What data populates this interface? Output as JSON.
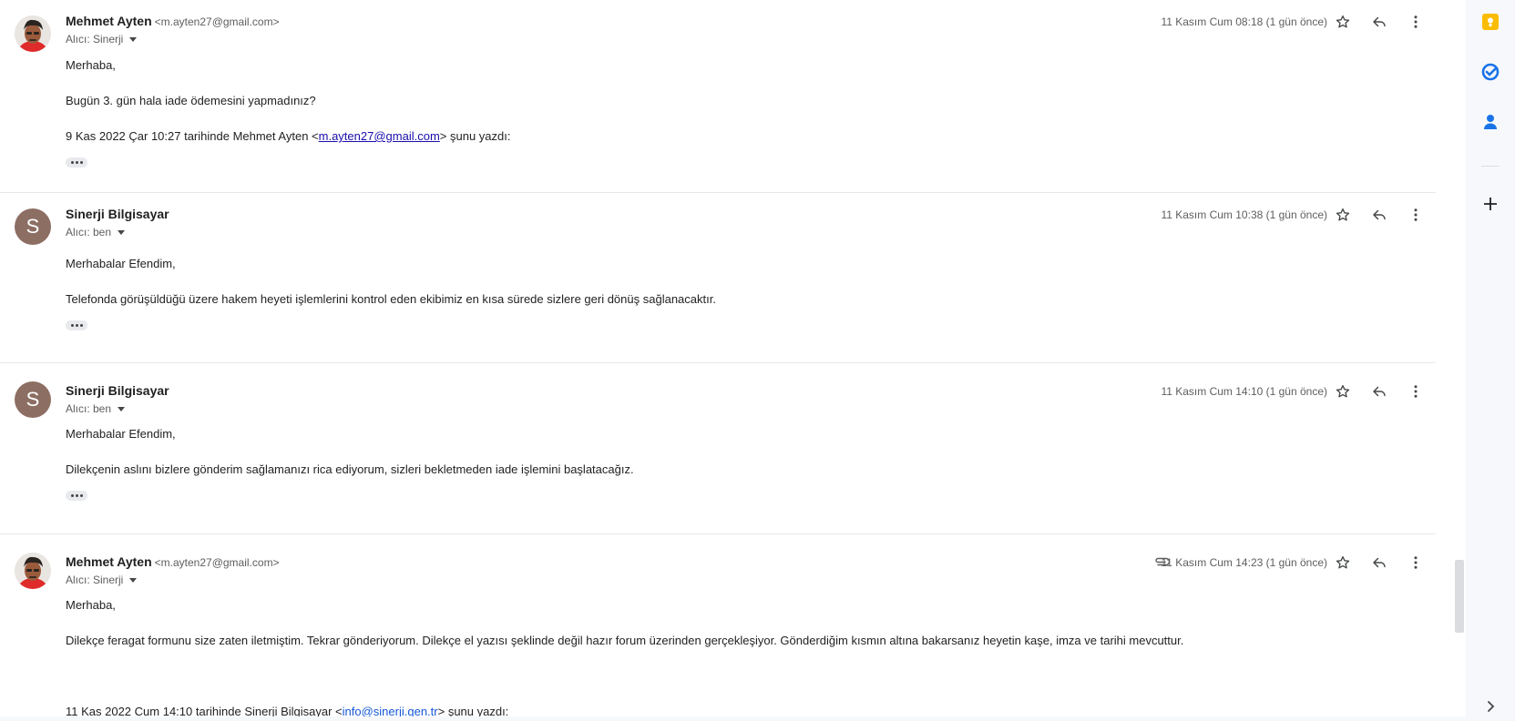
{
  "messages": [
    {
      "sender": "Mehmet Ayten",
      "email": "<m.ayten27@gmail.com>",
      "recipient": "Alıcı: Sinerji",
      "date": "11 Kasım Cum 08:18 (1 gün önce)",
      "lines": [
        "Merhaba,",
        "Bugün 3. gün hala iade ödemesini yapmadınız?"
      ],
      "quote_prefix": "9 Kas 2022 Çar 10:27 tarihinde Mehmet Ayten <",
      "quote_link": "m.ayten27@gmail.com",
      "quote_suffix": "> şunu yazdı:"
    },
    {
      "sender": "Sinerji Bilgisayar",
      "avatar_letter": "S",
      "recipient": "Alıcı: ben",
      "date": "11 Kasım Cum 10:38 (1 gün önce)",
      "lines": [
        "Merhabalar Efendim,",
        "Telefonda görüşüldüğü üzere hakem heyeti işlemlerini kontrol eden ekibimiz en kısa sürede sizlere geri dönüş sağlanacaktır."
      ]
    },
    {
      "sender": "Sinerji Bilgisayar",
      "avatar_letter": "S",
      "recipient": "Alıcı: ben",
      "date": "11 Kasım Cum 14:10 (1 gün önce)",
      "lines": [
        "Merhabalar Efendim,",
        "Dilekçenin aslını bizlere gönderim sağlamanızı rica ediyorum, sizleri bekletmeden iade işlemini başlatacağız."
      ]
    },
    {
      "sender": "Mehmet Ayten",
      "email": "<m.ayten27@gmail.com>",
      "recipient": "Alıcı: Sinerji",
      "date": "11 Kasım Cum 14:23 (1 gün önce)",
      "lines": [
        "Merhaba,",
        "Dilekçe feragat formunu size zaten iletmiştim. Tekrar gönderiyorum. Dilekçe el yazısı şeklinde değil hazır forum üzerinden gerçekleşiyor. Gönderdiğim kısmın altına bakarsanız heyetin kaşe, imza ve tarihi mevcuttur."
      ],
      "quote_prefix": "11 Kas 2022 Cum 14:10 tarihinde Sinerji Bilgisayar <",
      "quote_link": "info@sinerji.gen.tr",
      "quote_suffix": "> şunu yazdı:"
    }
  ],
  "colors": {
    "keep": "#fbbc04",
    "tasks": "#1a73e8",
    "contacts": "#1a73e8",
    "avatar_letter_bg": "#8d6e63"
  },
  "side_icons": [
    "keep-icon",
    "tasks-icon",
    "contacts-icon",
    "add-icon",
    "chevron-right-icon"
  ]
}
